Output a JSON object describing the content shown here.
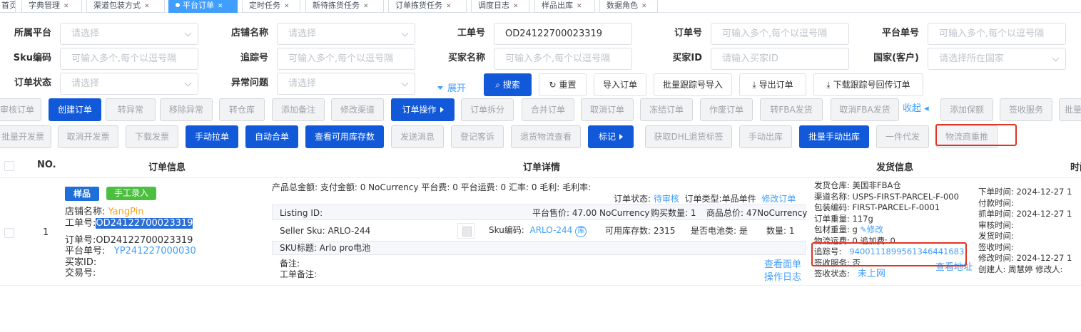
{
  "tabs": [
    {
      "label": "首页"
    },
    {
      "label": "字典管理"
    },
    {
      "label": "渠道包装方式"
    },
    {
      "label": "平台订单",
      "active": true
    },
    {
      "label": "定时任务"
    },
    {
      "label": "新待拣货任务"
    },
    {
      "label": "订单拣货任务"
    },
    {
      "label": "调度日志"
    },
    {
      "label": "样品出库"
    },
    {
      "label": "数据角色"
    }
  ],
  "filters": {
    "platform": {
      "label": "所属平台",
      "placeholder": "请选择"
    },
    "shop": {
      "label": "店铺名称",
      "placeholder": "请选择"
    },
    "work_no": {
      "label": "工单号",
      "value": "OD24122700023319"
    },
    "order_no": {
      "label": "订单号",
      "placeholder": "可输入多个,每个以逗号隔"
    },
    "platform_no": {
      "label": "平台单号",
      "placeholder": "可输入多个,每个以逗号隔"
    },
    "sku": {
      "label": "Sku编码",
      "placeholder": "可输入多个,每个以逗号隔"
    },
    "tracking": {
      "label": "追踪号",
      "placeholder": "可输入多个,每个以逗号隔"
    },
    "buyer_name": {
      "label": "买家名称",
      "placeholder": "可输入多个,每个以逗号隔"
    },
    "buyer_id": {
      "label": "买家ID",
      "placeholder": "请输入买家ID"
    },
    "country": {
      "label": "国家(客户)",
      "placeholder": "请选择所在国家"
    },
    "status": {
      "label": "订单状态",
      "placeholder": "请选择"
    },
    "issue": {
      "label": "异常问题",
      "placeholder": "请选择"
    },
    "expand": "展开"
  },
  "query_buttons": {
    "search": "搜索",
    "reset": "重置",
    "import_orders": "导入订单",
    "batch_tracking_import": "批量跟踪号导入",
    "export_orders": "导出订单",
    "download_tracking": "下载跟踪号回传订单"
  },
  "action_row1": [
    "审核订单",
    "创建订单",
    "转异常",
    "移除异常",
    "转仓库",
    "添加备注",
    "修改渠道",
    "订单操作",
    "订单拆分",
    "合并订单",
    "取消订单",
    "冻结订单",
    "作废订单",
    "转FBA发货",
    "取消FBA发货",
    "收起",
    "添加保额",
    "签收服务",
    "批量"
  ],
  "action_row2": [
    "批量开发票",
    "取消开发票",
    "下载发票",
    "手动拉单",
    "自动合单",
    "查看可用库存数",
    "发送消息",
    "登记客诉",
    "退货物流查看",
    "标记",
    "获取DHL退货标签",
    "手动出库",
    "批量手动出库",
    "一件代发",
    "物流商重推"
  ],
  "table": {
    "headers": {
      "no": "NO.",
      "order_info": "订单信息",
      "order_detail": "订单详情",
      "ship_info": "发货信息",
      "time": "时间"
    }
  },
  "row": {
    "no": "1",
    "badge_sample": "样品",
    "badge_manual": "手工录入",
    "shop_label": "店铺名称:",
    "shop_value": "YangPin",
    "work_label": "工单号:",
    "work_value": "OD24122700023319",
    "order_label": "订单号:",
    "order_value": "OD24122700023319",
    "platform_label": "平台单号:",
    "platform_value": "YP241227000030",
    "buyer_id_label": "买家ID:",
    "trade_label": "交易号:",
    "summary": "产品总金额:  支付金额: 0 NoCurrency  平台费: 0  平台运费: 0  汇率: 0  毛利:   毛利率:",
    "status_label": "订单状态:",
    "status_value": "待审核",
    "type_label": "订单类型:",
    "type_value": "单品单件",
    "edit_order": "修改订单",
    "listing_id": "Listing ID:",
    "list_price": "平台售价: 47.00 NoCurrency",
    "buy_qty": "购买数量: 1",
    "goods_total": "商品总价: 47NoCurrency",
    "seller_sku": "Seller Sku:  ARLO-244",
    "sku_code_label": "Sku编码:",
    "sku_code_value": "ARLO-244",
    "ku": "库",
    "avail_stock": "可用库存数: 2315",
    "battery": "是否电池类: 是",
    "qty": "数量: 1",
    "sku_title": "SKU标题:  Arlo pro电池",
    "remark": "备注:",
    "work_remark": "工单备注:",
    "view_label": "查看面单",
    "op_log": "操作日志",
    "ship_warehouse": "发货仓库: 美国非FBA仓",
    "channel_name": "渠道名称: USPS-FIRST-PARCEL-F-000",
    "pack_code": "包装编码: FIRST-PARCEL-F-0001",
    "order_weight": "订单重量: 117g",
    "material_weight": "包材重量: g",
    "edit_label": "修改",
    "logistics_fee": "物流运费: 0  追加费: 0",
    "tracking_label": "追踪号:",
    "tracking_value": "9400111899561346441683",
    "sign_service": "签收服务: 否",
    "view_address": "查看地址",
    "sign_status_label": "签收状态:",
    "sign_status_value": "未上网",
    "times": [
      "下单时间: 2024-12-27 1",
      "付款时间:",
      "抓单时间: 2024-12-27 1",
      "审核时间:",
      "发货时间:",
      "签收时间:",
      "修改时间: 2024-12-27 1",
      "创建人: 周慧婷   修改人:"
    ]
  },
  "colors": {
    "primary": "#1159d9",
    "link": "#409eff",
    "highlight": "#e03424",
    "tab_active": "#409eff"
  }
}
